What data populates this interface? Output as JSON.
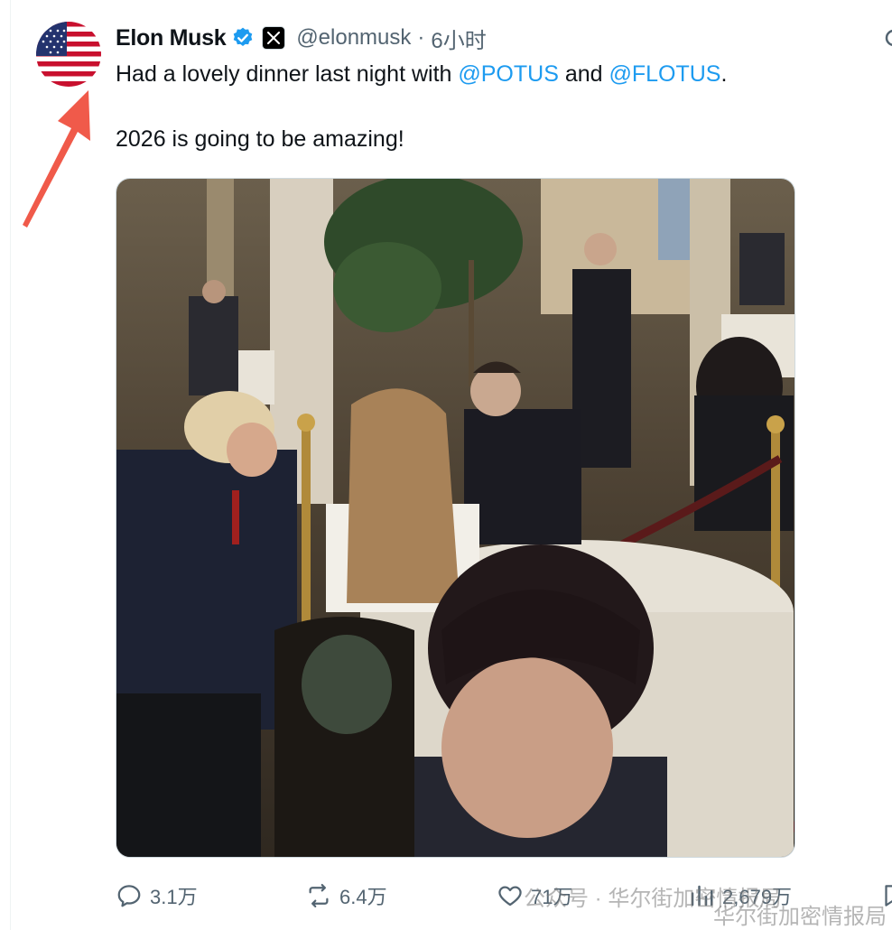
{
  "tweet": {
    "display_name": "Elon Musk",
    "handle": "@elonmusk",
    "separator": "·",
    "time": "6小时",
    "text_line1_before": "Had a lovely dinner last night with ",
    "mention1": "@POTUS",
    "text_line1_mid": " and ",
    "mention2": "@FLOTUS",
    "text_line1_after": ".",
    "text_line2": "2026 is going to be amazing!"
  },
  "actions": {
    "replies": "3.1万",
    "reposts": "6.4万",
    "likes": "71万",
    "views": "2,679万"
  },
  "watermark": {
    "line1": "公众号 · 华尔街加密情报局",
    "line2": "华尔街加密情报局"
  },
  "colors": {
    "accent": "#1d9bf0",
    "secondary_text": "#536471",
    "annotation_arrow": "#f05a4a"
  },
  "icons": [
    "verified-badge-icon",
    "x-logo-icon",
    "more-icon",
    "reply-icon",
    "repost-icon",
    "like-icon",
    "views-icon"
  ]
}
